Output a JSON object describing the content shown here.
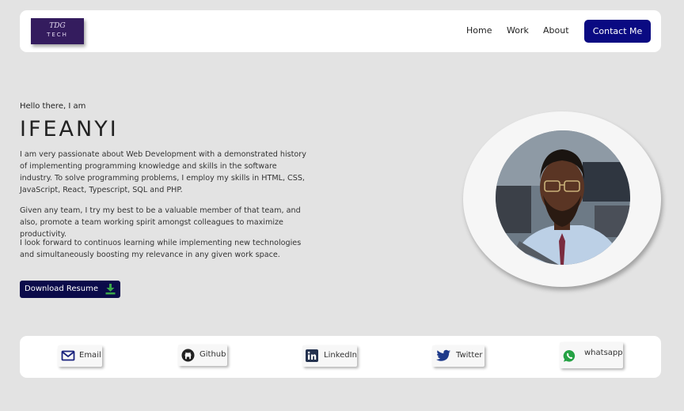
{
  "header": {
    "logo": {
      "top": "TDG",
      "bottom": "TECH"
    },
    "nav": {
      "home": "Home",
      "work": "Work",
      "about": "About"
    },
    "contact_label": "Contact Me"
  },
  "hero": {
    "greeting": "Hello there, I am",
    "name": "IFEANYI",
    "paragraphs": [
      "I am very passionate about Web Development with a demonstrated history of implementing programming knowledge and skills in the software industry. To solve programming problems, I employ my skills in HTML, CSS, JavaScript, React, Typescript, SQL and PHP.",
      "Given any team, I try my best to be a valuable member of that team, and also, promote a team working spirit amongst colleagues to maximize productivity.",
      "I look forward to continuos learning while implementing new technologies and simultaneously boosting my relevance in any given work space."
    ],
    "resume_label": "Download Resume",
    "resume_icon": "download-icon"
  },
  "social": {
    "items": [
      {
        "label": "Email",
        "icon": "mail-icon"
      },
      {
        "label": "Github",
        "icon": "github-icon"
      },
      {
        "label": "LinkedIn",
        "icon": "linkedin-icon"
      },
      {
        "label": "Twitter",
        "icon": "twitter-icon"
      },
      {
        "label": "whatsapp",
        "icon": "whatsapp-icon"
      }
    ]
  },
  "colors": {
    "page_bg": "#e3e3e3",
    "accent": "#0a0a82",
    "resume_bg": "#0b0b4a",
    "logo_bg": "#341c5e"
  }
}
